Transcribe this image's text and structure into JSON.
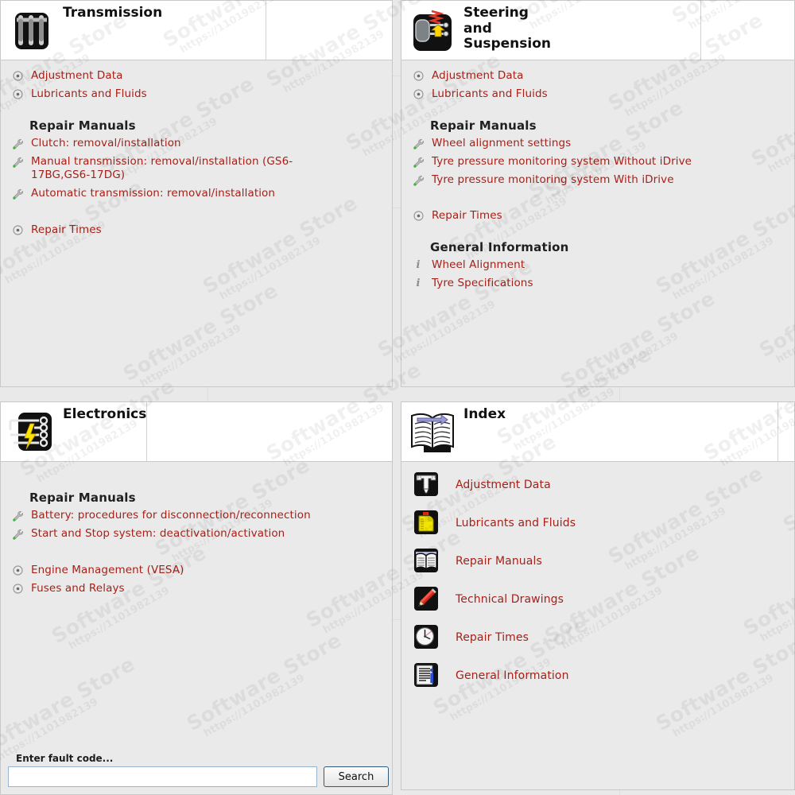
{
  "watermark": {
    "line1": "Software Store",
    "line2": "https://1101982139"
  },
  "colors": {
    "link": "#a62119",
    "heading": "#202020",
    "panel_bg": "#eaeaea",
    "header_bg": "#ffffff",
    "border": "#c8c8c8"
  },
  "panels": {
    "transmission": {
      "title": "Transmission",
      "icon": "transmission-gears-icon",
      "groups": [
        {
          "type": "links",
          "items": [
            {
              "label": "Adjustment Data",
              "icon": "bullet-dot-icon"
            },
            {
              "label": "Lubricants and Fluids",
              "icon": "bullet-dot-icon"
            }
          ]
        },
        {
          "type": "section",
          "heading": "Repair Manuals",
          "items": [
            {
              "label": "Clutch: removal/installation",
              "icon": "wrench-icon"
            },
            {
              "label": "Manual transmission: removal/installation (GS6-17BG,GS6-17DG)",
              "icon": "wrench-icon"
            },
            {
              "label": "Automatic transmission: removal/installation",
              "icon": "wrench-icon"
            }
          ]
        },
        {
          "type": "links",
          "items": [
            {
              "label": "Repair Times",
              "icon": "bullet-dot-icon"
            }
          ]
        }
      ]
    },
    "steering": {
      "title": "Steering and Suspension",
      "icon": "suspension-strut-icon",
      "groups": [
        {
          "type": "links",
          "items": [
            {
              "label": "Adjustment Data",
              "icon": "bullet-dot-icon"
            },
            {
              "label": "Lubricants and Fluids",
              "icon": "bullet-dot-icon"
            }
          ]
        },
        {
          "type": "section",
          "heading": "Repair Manuals",
          "items": [
            {
              "label": "Wheel alignment settings",
              "icon": "wrench-icon"
            },
            {
              "label": "Tyre pressure monitoring system Without iDrive",
              "icon": "wrench-icon"
            },
            {
              "label": "Tyre pressure monitoring system With iDrive",
              "icon": "wrench-icon"
            }
          ]
        },
        {
          "type": "links",
          "items": [
            {
              "label": "Repair Times",
              "icon": "bullet-dot-icon"
            }
          ]
        },
        {
          "type": "section",
          "heading": "General Information",
          "items": [
            {
              "label": "Wheel Alignment",
              "icon": "info-i-icon"
            },
            {
              "label": "Tyre Specifications",
              "icon": "info-i-icon"
            }
          ]
        }
      ]
    },
    "electronics": {
      "title": "Electronics",
      "icon": "electronics-circuit-icon",
      "groups": [
        {
          "type": "section",
          "heading": "Repair Manuals",
          "items": [
            {
              "label": "Battery: procedures for disconnection/reconnection",
              "icon": "wrench-icon"
            },
            {
              "label": "Start and Stop system: deactivation/activation",
              "icon": "wrench-icon"
            }
          ]
        },
        {
          "type": "links",
          "items": [
            {
              "label": "Engine Management (VESA)",
              "icon": "bullet-dot-icon"
            },
            {
              "label": "Fuses and Relays",
              "icon": "bullet-dot-icon"
            }
          ]
        }
      ]
    },
    "index": {
      "title": "Index",
      "icon": "open-book-arrow-icon",
      "items": [
        {
          "label": "Adjustment Data",
          "icon": "caliper-icon"
        },
        {
          "label": "Lubricants and Fluids",
          "icon": "oil-can-icon"
        },
        {
          "label": "Repair Manuals",
          "icon": "open-book-icon"
        },
        {
          "label": "Technical Drawings",
          "icon": "pencil-ruler-icon"
        },
        {
          "label": "Repair Times",
          "icon": "clock-icon"
        },
        {
          "label": "General Information",
          "icon": "document-info-icon"
        }
      ]
    }
  },
  "search": {
    "label": "Enter fault code...",
    "value": "",
    "placeholder": "",
    "button_label": "Search"
  }
}
